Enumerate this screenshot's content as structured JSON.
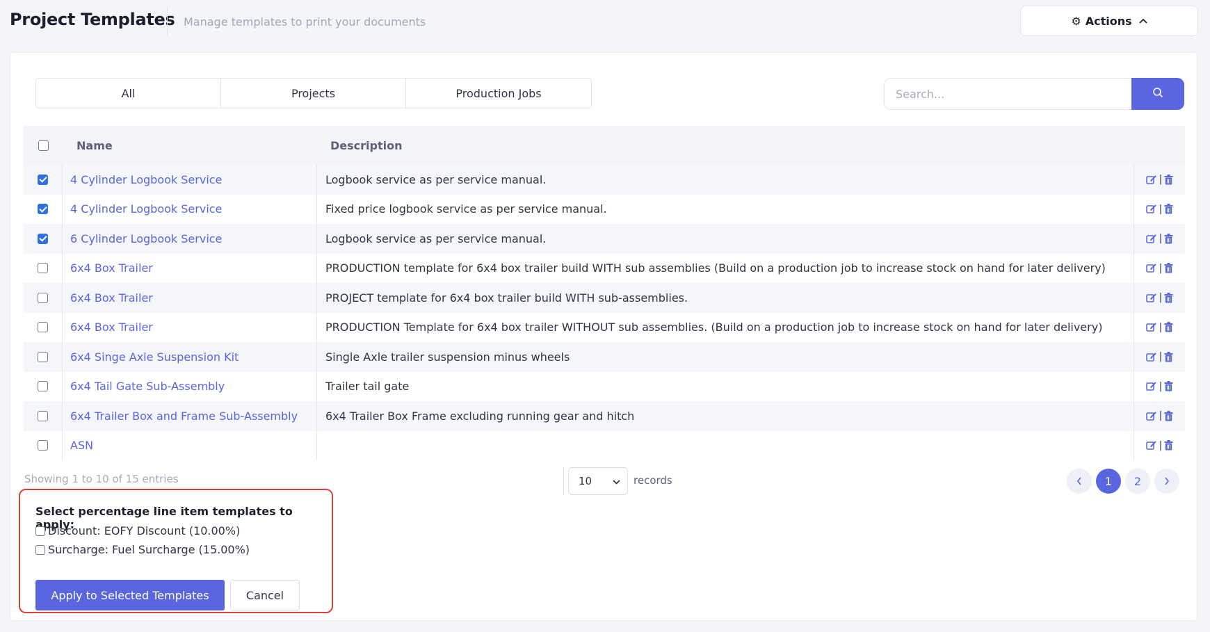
{
  "header": {
    "title": "Project Templates",
    "subtitle": "Manage templates to print your documents",
    "actions_label": "Actions"
  },
  "tabs": [
    {
      "label": "All"
    },
    {
      "label": "Projects"
    },
    {
      "label": "Production Jobs"
    }
  ],
  "search": {
    "placeholder": "Search..."
  },
  "table": {
    "columns": {
      "name": "Name",
      "description": "Description"
    },
    "rows": [
      {
        "name": "4 Cylinder Logbook Service",
        "description": "Logbook service as per service manual.",
        "checked": true
      },
      {
        "name": "4 Cylinder Logbook Service",
        "description": "Fixed price logbook service as per service manual.",
        "checked": true
      },
      {
        "name": "6 Cylinder Logbook Service",
        "description": "Logbook service as per service manual.",
        "checked": true
      },
      {
        "name": "6x4 Box Trailer",
        "description": "PRODUCTION template for 6x4 box trailer build WITH sub assemblies (Build on a production job to increase stock on hand for later delivery)",
        "checked": false
      },
      {
        "name": "6x4 Box Trailer",
        "description": "PROJECT template for 6x4 box trailer build WITH sub-assemblies.",
        "checked": false
      },
      {
        "name": "6x4 Box Trailer",
        "description": "PRODUCTION Template for 6x4 box trailer WITHOUT sub assemblies. (Build on a production job to increase stock on hand for later delivery)",
        "checked": false
      },
      {
        "name": "6x4 Singe Axle Suspension Kit",
        "description": "Single Axle trailer suspension minus wheels",
        "checked": false
      },
      {
        "name": "6x4 Tail Gate Sub-Assembly",
        "description": "Trailer tail gate",
        "checked": false
      },
      {
        "name": "6x4 Trailer Box and Frame Sub-Assembly",
        "description": "6x4 Trailer Box Frame excluding running gear and hitch",
        "checked": false
      },
      {
        "name": "ASN",
        "description": "",
        "checked": false
      }
    ]
  },
  "footer": {
    "entries_info": "Showing 1 to 10 of 15 entries",
    "page_length": "10",
    "records_label": "records",
    "pages": [
      "1",
      "2"
    ],
    "current_page": "1"
  },
  "percentage_panel": {
    "title": "Select percentage line item templates to apply:",
    "options": [
      {
        "label": "Discount: EOFY Discount (10.00%)",
        "checked": false
      },
      {
        "label": "Surcharge: Fuel Surcharge (15.00%)",
        "checked": false
      }
    ],
    "apply_label": "Apply to Selected Templates",
    "cancel_label": "Cancel"
  },
  "colors": {
    "accent": "#5a65e0",
    "highlight_border": "#d9443a",
    "checkbox_checked": "#2f6fe0"
  },
  "icons": [
    "gear-icon",
    "chevron-up-icon",
    "search-icon",
    "edit-icon",
    "trash-icon",
    "chevron-down-icon",
    "chevron-left-icon",
    "chevron-right-icon"
  ]
}
